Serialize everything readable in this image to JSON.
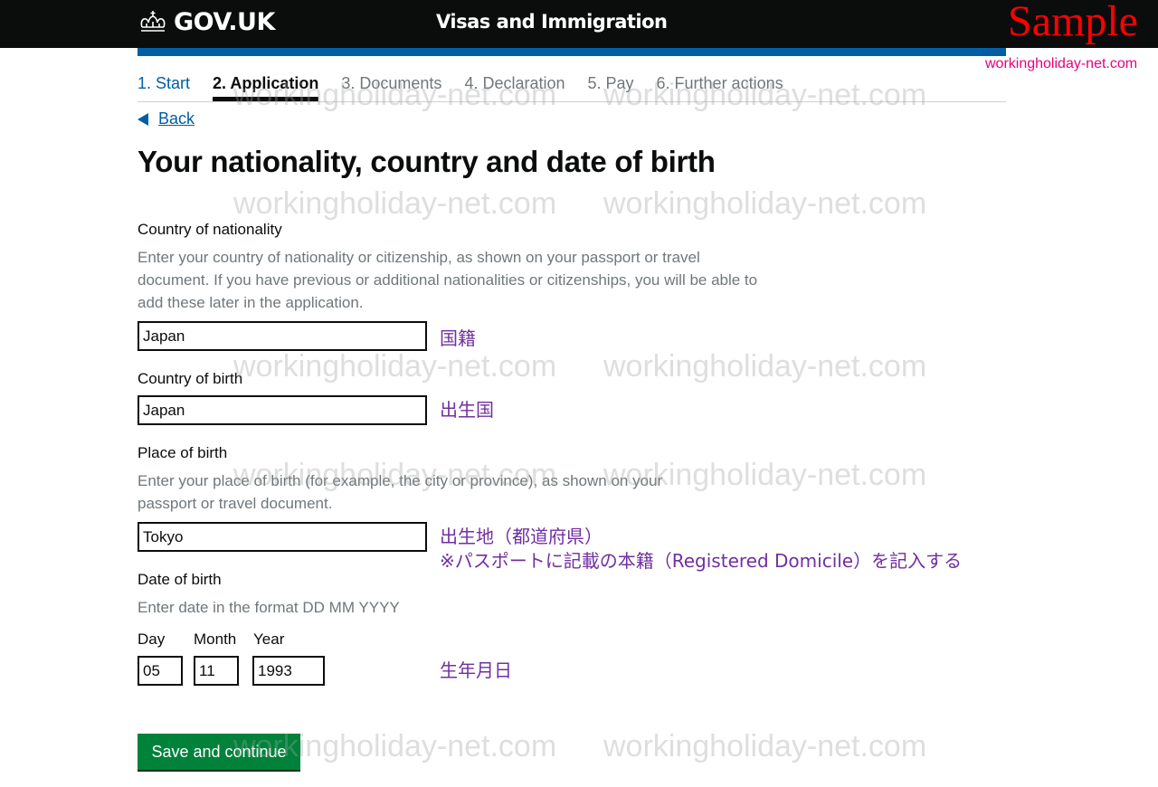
{
  "header": {
    "logo_text": "GOV.UK",
    "service_name": "Visas and Immigration",
    "overlay_label": "Sample",
    "site_mark": "workingholiday-net.com"
  },
  "steps": [
    {
      "label": "1. Start",
      "state": "done"
    },
    {
      "label": "2. Application",
      "state": "active"
    },
    {
      "label": "3. Documents",
      "state": "pending"
    },
    {
      "label": "4. Declaration",
      "state": "pending"
    },
    {
      "label": "5. Pay",
      "state": "pending"
    },
    {
      "label": "6. Further actions",
      "state": "pending"
    }
  ],
  "back_label": "Back",
  "page_title": "Your nationality, country and date of birth",
  "fields": {
    "nationality": {
      "label": "Country of nationality",
      "hint": "Enter your country of nationality or citizenship, as shown on your passport or travel document. If you have previous or additional nationalities or citizenships, you will be able to add these later in the application.",
      "value": "Japan",
      "note": "国籍"
    },
    "country_of_birth": {
      "label": "Country of birth",
      "value": "Japan",
      "note": "出生国"
    },
    "place_of_birth": {
      "label": "Place of birth",
      "hint": "Enter your place of birth (for example, the city or province), as shown on your passport or travel document.",
      "value": "Tokyo",
      "note_line1": "出生地（都道府県）",
      "note_line2": "※パスポートに記載の本籍（Registered Domicile）を記入する"
    },
    "date_of_birth": {
      "label": "Date of birth",
      "hint": "Enter date in the format DD MM YYYY",
      "day_label": "Day",
      "month_label": "Month",
      "year_label": "Year",
      "day": "05",
      "month": "11",
      "year": "1993",
      "note": "生年月日"
    }
  },
  "save_button": "Save and continue",
  "watermark_text": "workingholiday-net.com"
}
